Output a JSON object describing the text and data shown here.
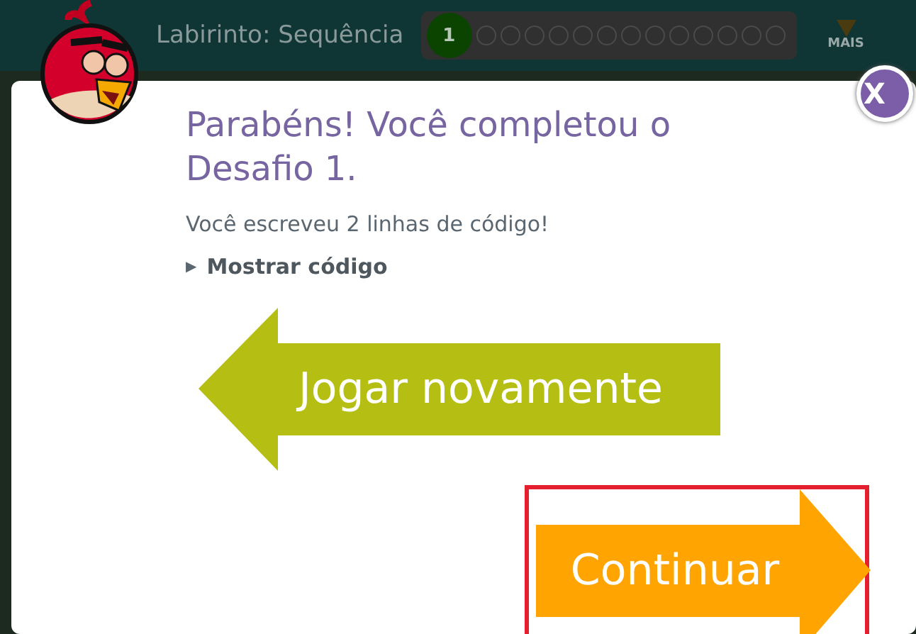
{
  "header": {
    "title": "Labirinto: Sequência",
    "progress": [
      {
        "label": "1",
        "selected": true
      },
      {
        "selected": false
      },
      {
        "selected": false
      },
      {
        "selected": false
      },
      {
        "selected": false
      },
      {
        "selected": false
      },
      {
        "selected": false
      },
      {
        "selected": false
      },
      {
        "selected": false
      },
      {
        "selected": false
      },
      {
        "selected": false
      },
      {
        "selected": false
      },
      {
        "selected": false
      },
      {
        "selected": false
      }
    ],
    "more": "MAIS"
  },
  "dialog": {
    "close": "X",
    "title": "Parabéns! Você completou o Desafio 1.",
    "message": "Você escreveu 2 linhas de código!",
    "code_toggle": {
      "icon": "▶",
      "label": "Mostrar código",
      "expanded": false
    },
    "buttons": [
      {
        "kind": "back",
        "label": "Jogar novamente",
        "highlighted": false
      },
      {
        "kind": "forward",
        "label": "Continuar",
        "highlighted": true
      }
    ]
  }
}
